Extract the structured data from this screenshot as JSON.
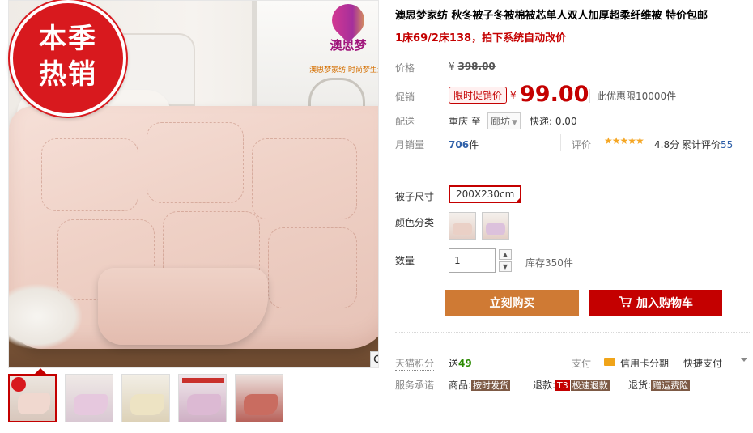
{
  "gallery": {
    "badge_line1": "本季",
    "badge_line2": "热销",
    "brand_logo_text": "澳思梦",
    "brand_slogan": "澳思梦家纺  时尚梦生活",
    "thumbnails": [
      {
        "name": "thumb-1",
        "color": "#f0d8cf",
        "active": true
      },
      {
        "name": "thumb-2",
        "color": "#e6c8de"
      },
      {
        "name": "thumb-3",
        "color": "#ede3c3"
      },
      {
        "name": "thumb-4",
        "color": "#dcb9d3"
      },
      {
        "name": "thumb-5",
        "color": "#c96c60"
      }
    ]
  },
  "product": {
    "title": "澳思梦家纺 秋冬被子冬被棉被芯单人双人加厚超柔纤维被 特价包邮",
    "subtitle": "1床69/2床138，拍下系统自动改价"
  },
  "price": {
    "label": "价格",
    "currency": "¥",
    "original": "398.00",
    "promo_label": "促销",
    "promo_tag": "限时促销价",
    "current": "99.00",
    "promo_limit": "此优惠限10000件"
  },
  "shipping": {
    "label": "配送",
    "from": "重庆",
    "to_word": "至",
    "destination": "廊坊",
    "fee": "快递: 0.00"
  },
  "sales": {
    "label": "月销量",
    "count": "706",
    "unit": "件",
    "rating_label": "评价",
    "stars": "★★★★★",
    "score": "4.8分",
    "review_prefix": "累计评价",
    "review_count": "55"
  },
  "options": {
    "size_label": "被子尺寸",
    "size_value": "200X230cm",
    "color_label": "颜色分类",
    "swatches": [
      {
        "name": "color-swatch-pink",
        "color": "#ead0c6"
      },
      {
        "name": "color-swatch-purple",
        "color": "#dcc1dc"
      }
    ],
    "qty_label": "数量",
    "qty_value": "1",
    "qty_up": "▲",
    "qty_down": "▼",
    "stock": "库存350件"
  },
  "actions": {
    "buy_now": "立刻购买",
    "add_cart": "加入购物车"
  },
  "extras": {
    "points_label": "天猫积分",
    "points_prefix": "送",
    "points_value": "49",
    "pay_label": "支付",
    "pay_card": "信用卡分期",
    "pay_express": "快捷支付",
    "service_label": "服务承诺",
    "service_goods_label": "商品:",
    "service_goods_badge": "按时发货",
    "service_refund_label": "退款:",
    "service_refund_t3": "T3",
    "service_refund_badge": "极速退款",
    "service_return_label": "退货:",
    "service_return_badge": "赠运费险"
  },
  "colors": {
    "accent": "#c40000",
    "buy_now": "#cf7a34",
    "badge": "#d8191e",
    "link": "#2e5fa8"
  }
}
